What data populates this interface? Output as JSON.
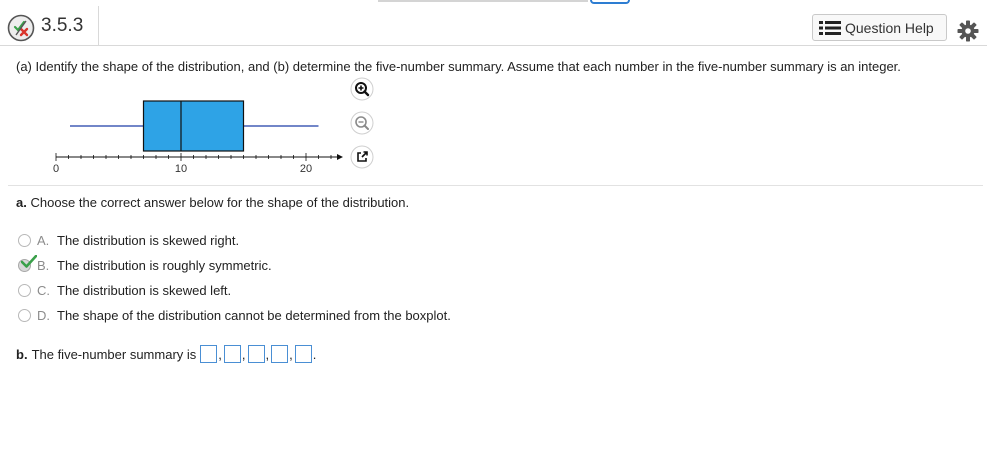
{
  "header": {
    "question_number": "3.5.3",
    "help_label": "Question Help"
  },
  "prompt": "(a) Identify the shape of the distribution, and (b) determine the five-number summary. Assume that each number in the five-number summary is an integer.",
  "boxplot": {
    "axis_ticks": [
      "0",
      "10",
      "20"
    ],
    "whisker_min": 0,
    "q1": 7,
    "median": 10,
    "q3": 15,
    "whisker_max": 21,
    "axis_min": 0,
    "axis_max": 22,
    "box_color": "#2ea3e6"
  },
  "part_a": {
    "label": "a.",
    "text": "Choose the correct answer below for the shape of the distribution.",
    "options": [
      {
        "letter": "A.",
        "text": "The distribution is skewed right.",
        "selected": false
      },
      {
        "letter": "B.",
        "text": "The distribution is roughly symmetric.",
        "selected": true
      },
      {
        "letter": "C.",
        "text": "The distribution is skewed left.",
        "selected": false
      },
      {
        "letter": "D.",
        "text": "The shape of the distribution cannot be determined from the boxplot.",
        "selected": false
      }
    ]
  },
  "part_b": {
    "label": "b.",
    "text": "The five-number summary is",
    "separators": [
      ",",
      ",",
      ",",
      ",",
      "."
    ]
  },
  "colors": {
    "accent": "#2d7dd2",
    "check": "#3aa04a",
    "wrong_x": "#d9342b"
  }
}
